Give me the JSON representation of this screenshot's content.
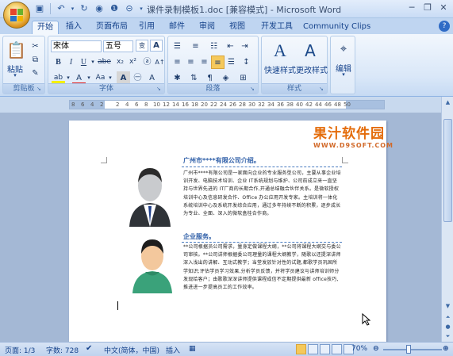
{
  "window": {
    "title": "课件录制模板1.doc [兼容模式] - Microsoft Word",
    "qat": [
      "save-icon",
      "undo-icon",
      "redo-icon",
      "circle-icon",
      "info-icon",
      "customize-icon"
    ]
  },
  "tabs": [
    {
      "label": "开始",
      "active": true
    },
    {
      "label": "插入"
    },
    {
      "label": "页面布局"
    },
    {
      "label": "引用"
    },
    {
      "label": "邮件"
    },
    {
      "label": "审阅"
    },
    {
      "label": "视图"
    },
    {
      "label": "开发工具"
    },
    {
      "label": "Community Clips"
    }
  ],
  "ribbon": {
    "clipboard": {
      "label": "剪贴板",
      "paste": "粘贴"
    },
    "font": {
      "label": "字体",
      "font_name": "宋体",
      "font_size": "五号",
      "change_case": "Aa"
    },
    "paragraph": {
      "label": "段落"
    },
    "styles": {
      "label": "样式",
      "quick_styles": "快速样式",
      "change_styles": "更改样式"
    },
    "editing": {
      "label": "编辑"
    }
  },
  "ruler": {
    "ticks": [
      "8",
      "6",
      "4",
      "2",
      "",
      "2",
      "4",
      "6",
      "8",
      "10",
      "12",
      "14",
      "16",
      "18",
      "20",
      "22",
      "24",
      "26",
      "28",
      "30",
      "32",
      "34",
      "36",
      "38",
      "40",
      "42",
      "44",
      "46",
      "48",
      "50"
    ]
  },
  "watermark": {
    "main": "果汁软件园",
    "sub": "WWW.D9SOFT.COM"
  },
  "document": {
    "heading1": "广州市****有限公司介绍。",
    "para1": "广州市****有限公司是一家面向企业的专业服务型公司，主要从事企业培训开发、电脑技术培训、企业 IT系统规划与维护、公司前成立来一直坚持与世界先进的 IT厂商的长期合作,开通总结融合伙伴关系。是微软授权培训中心及信息研发合作、Office 办公应用开发专家。主培训将一体化系统培训中心及系统开发综合应用，通过多年持续不断的积累，逐步成长为专业、全面、深入的微软盒桂合作商。",
    "heading2": "企业服务。",
    "para2": "**公司根据员公司需求，量身定做课程大纲，**公司将课程大纲交与委公司审核。**公司讲师根据委公司理量的课程大纲教学，随歌以还提深讲师深入浅出的讲解、互动式教学；当堂发放针对性的试题,都歌学员巩固所学知识;评估学员学习效果,分析学员反馈，并将学员建议与讲师培训师分发现给客户；由歌歌深深讲师提供课程成信不定期提供最新 office技巧,推进进一步提高员工的工作效率。"
  },
  "status": {
    "page": "页面: 1/3",
    "words": "字数: 728",
    "language": "中文(简体，中国)",
    "insert_mode": "插入",
    "zoom": "70%"
  }
}
